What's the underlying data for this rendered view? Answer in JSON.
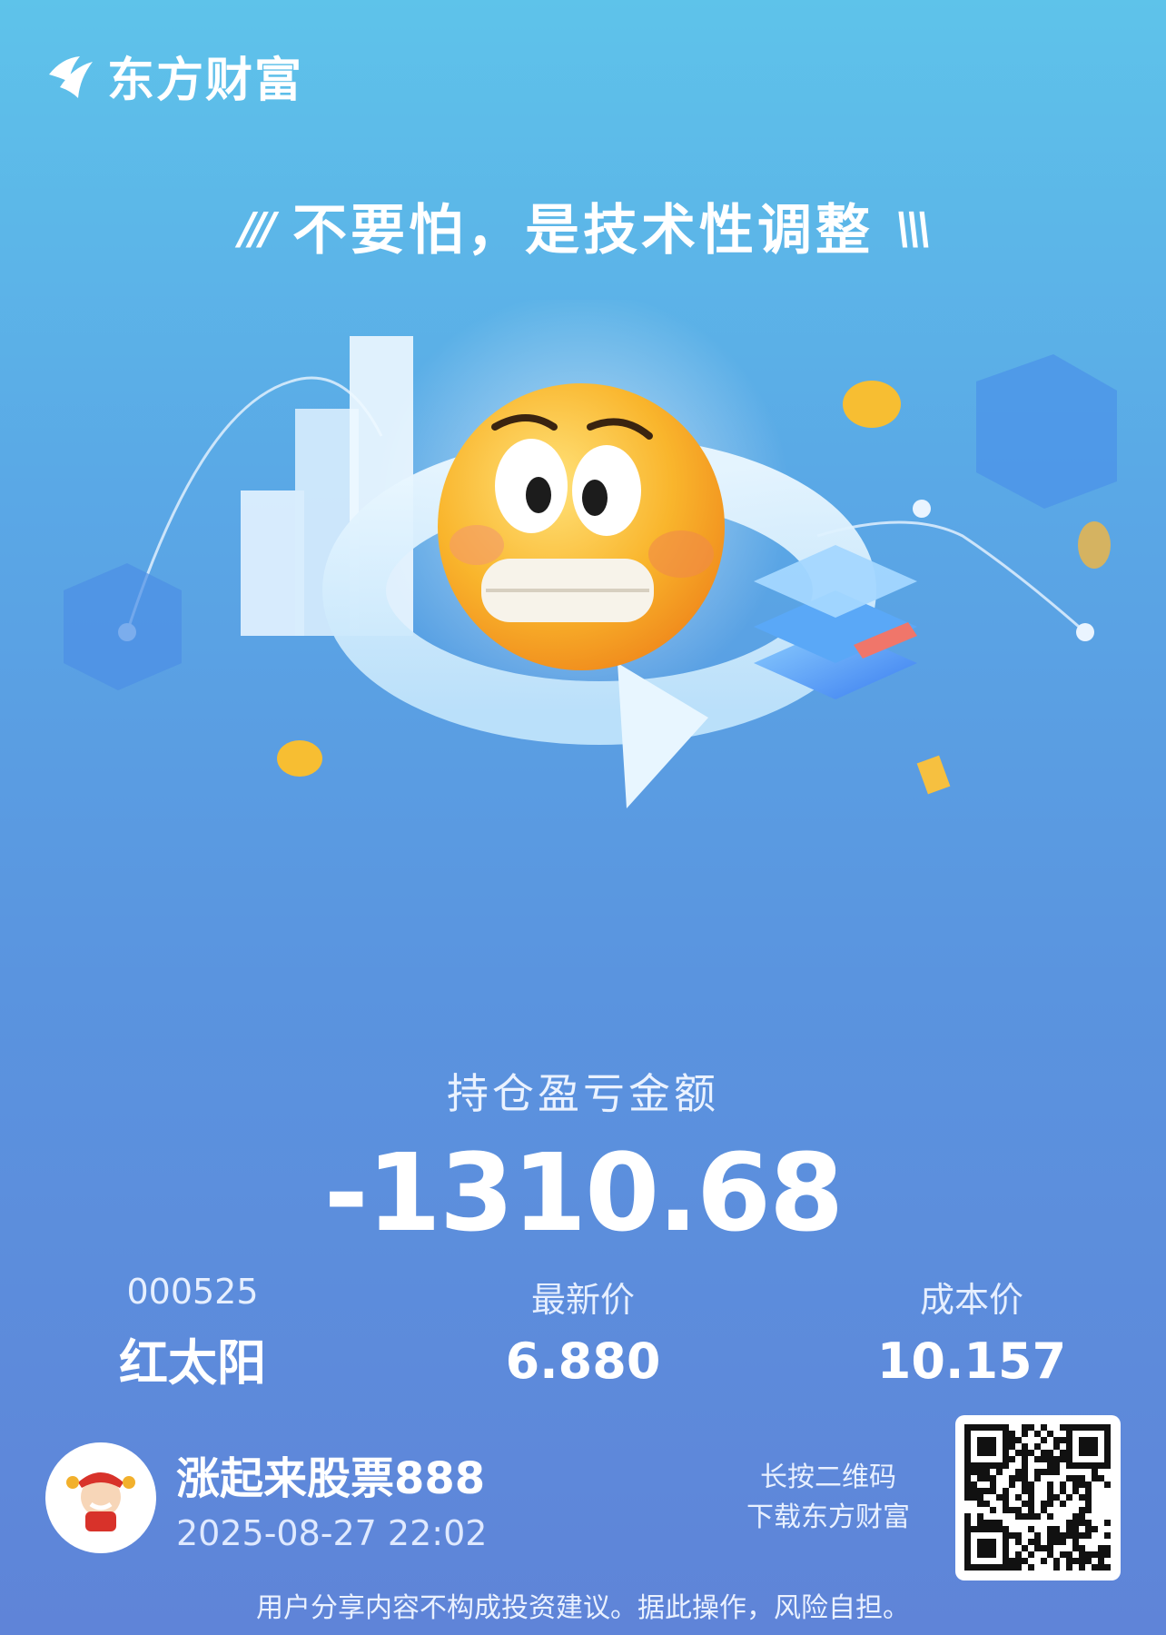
{
  "brand": {
    "name": "东方财富"
  },
  "slogan": {
    "left_marks": "///",
    "text": "不要怕，是技术性调整",
    "right_marks": "\\\\\\"
  },
  "summary": {
    "label": "持仓盈亏金额",
    "value": "-1310.68"
  },
  "stock": {
    "code": "000525",
    "name": "红太阳"
  },
  "latest_price": {
    "label": "最新价",
    "value": "6.880"
  },
  "cost_price": {
    "label": "成本价",
    "value": "10.157"
  },
  "user": {
    "name": "涨起来股票888",
    "timestamp": "2025-08-27 22:02"
  },
  "qr_tip": {
    "line1": "长按二维码",
    "line2": "下载东方财富"
  },
  "disclaimer": "用户分享内容不构成投资建议。据此操作，风险自担。",
  "colors": {
    "background_top": "#5ec3ea",
    "background_bottom": "#5f84d8",
    "emoji": "#f7b928"
  }
}
